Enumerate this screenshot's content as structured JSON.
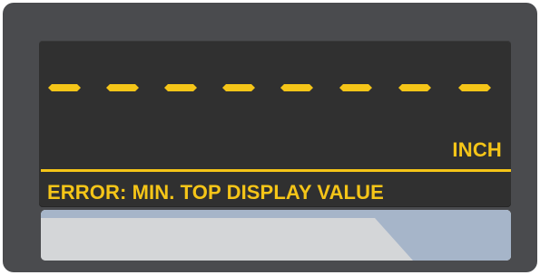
{
  "display": {
    "reading_placeholder": "- - - - - - - -",
    "unit": "INCH",
    "status_message": "ERROR: MIN. TOP DISPLAY VALUE",
    "dash_count": 8
  },
  "colors": {
    "bezel": "#4a4b4e",
    "lcd_background": "#303030",
    "segment": "#f5c518",
    "softkey_light": "#d4d6d8",
    "softkey_accent": "#a6b5c9"
  }
}
